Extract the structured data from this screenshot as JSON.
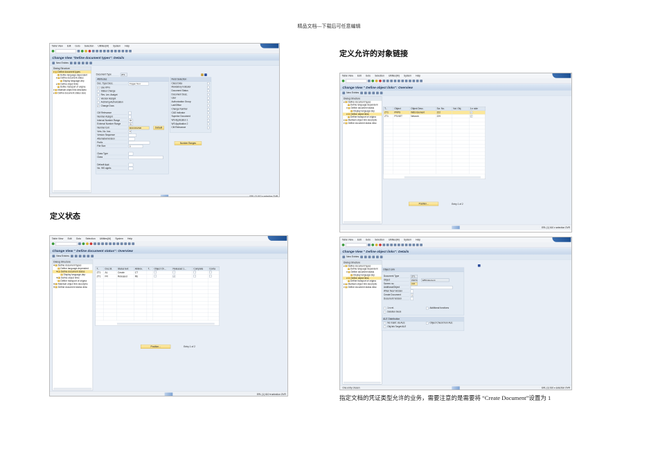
{
  "header_note": "精品文档---下载后可任意编辑",
  "headings": {
    "status": "定义状态",
    "object_links": "定义允许的对象链接"
  },
  "caption": "指定文档的凭证类型允许的业务，需要注意的是需要将 “Create Document”设置为 1",
  "common": {
    "menu": [
      "Table View",
      "Edit",
      "Goto",
      "Selection",
      "Utilities(M)",
      "System",
      "Help"
    ],
    "new_entries": "New Entries",
    "tree_title": "Dialog Structure",
    "tree": [
      {
        "label": "Define document types",
        "lvl": 0
      },
      {
        "label": "Define language-dependent",
        "lvl": 1
      },
      {
        "label": "Define document status",
        "lvl": 1
      },
      {
        "label": "Display language-dep",
        "lvl": 2
      },
      {
        "label": "Define object links",
        "lvl": 1
      },
      {
        "label": "Define transport of origina",
        "lvl": 1
      },
      {
        "label": "Maintain object link descriptio",
        "lvl": 0
      },
      {
        "label": "Define document status desc",
        "lvl": 0
      }
    ],
    "status_right": "ERL (1) 610  ▾  selection  OVR",
    "position_btn": "Position...",
    "entry_info": "Entry 1 of 2"
  },
  "win1": {
    "title": "Change View \"Define document types\": Details",
    "doc_type_label": "Document Type",
    "doc_type": "ZT1",
    "attributes_title": "Attributes",
    "desc_label": "Doc. Type Desc.",
    "desc": "Trigger Test",
    "checks": [
      {
        "label": "Use KPro",
        "on": true
      },
      {
        "label": "Status Change",
        "on": false
      },
      {
        "label": "Rev. Lev. Assignt",
        "on": false
      },
      {
        "label": "Version Assignt",
        "on": false
      },
      {
        "label": "Archiving Authorization",
        "on": false
      },
      {
        "label": "Change Docs",
        "on": true
      }
    ],
    "fields": [
      {
        "label": "CM Relevance",
        "value": ""
      },
      {
        "label": "Number Assignt",
        "value": ""
      },
      {
        "label": "Internal Number Range",
        "value": "02"
      },
      {
        "label": "External Number Range",
        "value": "01"
      },
      {
        "label": "Number Exit",
        "value": "MCDOKZNR"
      },
      {
        "label": "Vers. No. Incr.",
        "value": "0"
      },
      {
        "label": "Version Sequence",
        "value": ""
      },
      {
        "label": "AlternativeVersion",
        "value": ""
      },
      {
        "label": "Prefix",
        "value": ""
      },
      {
        "label": "File Size",
        "value": "0"
      },
      {
        "label": "Class Type",
        "value": ""
      },
      {
        "label": "Class",
        "value": ""
      },
      {
        "label": "Default Appl.",
        "value": ""
      },
      {
        "label": "No. WS applic.",
        "value": ""
      }
    ],
    "default_btn": "Default",
    "field_sel_title": "Field Selection",
    "field_sel": [
      "Class Data",
      "Mandatory Indicator",
      "Document Status",
      "Document Desc.",
      "User",
      "Authorization Group",
      "Lab/Office",
      "Change Number",
      "CAD Indicator",
      "Superior Document",
      "WS Application 1",
      "WS Application 2",
      "CM Relevance"
    ],
    "number_ranges_btn": "Number Ranges"
  },
  "win2": {
    "title": "Change View \" Define document status\": Overview",
    "columns": [
      "T..",
      "Doc.St.",
      "Status text",
      "Abbrev.",
      "T..",
      "Object Ch...",
      "Released 1...",
      "Complete",
      "Conta"
    ],
    "rows": [
      {
        "type": "ZT1",
        "st": "AL",
        "text": "Create",
        "abbr": "CT",
        "released": false
      },
      {
        "type": "ZT1",
        "st": "FR",
        "text": "Released",
        "abbr": "RE",
        "released": true
      }
    ]
  },
  "win3": {
    "title": "Change View \" Define object links\": Overview",
    "columns": [
      "T..",
      "Object",
      "Object Desc.",
      "Scr. No.",
      "Val. Obj.",
      "1:n side"
    ],
    "rows": [
      {
        "type": "ZT1",
        "object": "PRPS",
        "desc": "WBS Element",
        "scr": "222"
      },
      {
        "type": "ZT1",
        "object": "PS:NET",
        "desc": "Network",
        "scr": "229"
      }
    ]
  },
  "win4": {
    "title": "Change View \" Define object links\": Details",
    "group1": "Object Link",
    "fields": [
      {
        "label": "Document Type",
        "value": "ZT1"
      },
      {
        "label": "Object",
        "value": "PRPS",
        "extra": "WBS Element"
      },
      {
        "label": "Screen no.",
        "value": "222"
      },
      {
        "label": "AdditionalObject",
        "value": ""
      },
      {
        "label": "When New Version",
        "value": ""
      },
      {
        "label": "Create Document",
        "value": "1"
      },
      {
        "label": "Document Version",
        "value": ""
      }
    ],
    "checks": [
      "1:n rel.",
      "Deletion block",
      "Additional functions"
    ],
    "group2": "ALE Distribution",
    "ale": [
      "No maint. via ALE",
      "Object Check from ALE",
      "Obj.link Target ALE"
    ],
    "status_left": "One entry chosen"
  }
}
